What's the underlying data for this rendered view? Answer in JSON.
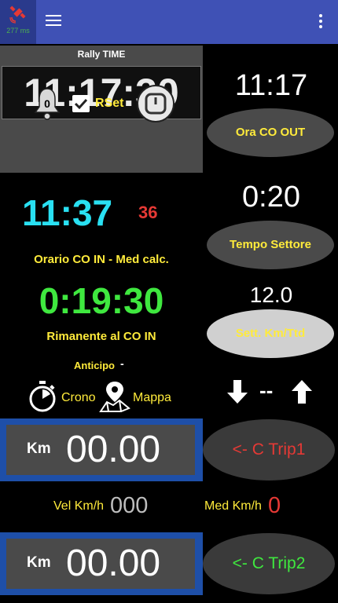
{
  "app_bar": {
    "gps_latency": "277 ms",
    "colors": {
      "bar": "#3f51b5",
      "gps_tile": "#2a3a8c",
      "gps_icon": "#e53935"
    }
  },
  "rally": {
    "title": "Rally TIME",
    "clock": "11:17:30",
    "bell_count": "0",
    "rset_label": "RSet",
    "rset_checked": true
  },
  "co_in": {
    "time": "11:37",
    "red_value": "36",
    "label": "Orario CO IN - Med calc.",
    "remaining_time": "0:19:30",
    "remaining_label": "Rimanente al CO IN",
    "anticipo_label": "Anticipo",
    "anticipo_value": "-"
  },
  "tools": {
    "crono_label": "Crono",
    "mappa_label": "Mappa"
  },
  "right": {
    "ora_co_out_value": "11:17",
    "ora_co_out_button": "Ora CO OUT",
    "tempo_settore_value": "0:20",
    "tempo_settore_button": "Tempo Settore",
    "sett_km_value": "12.0",
    "sett_km_button": "Sett. Km/Ttd",
    "arrow_separator": "--"
  },
  "trip1": {
    "km_label": "Km",
    "km_value": "00.00",
    "button": "<- C Trip1",
    "button_color": "#e53935"
  },
  "speed": {
    "vel_label": "Vel Km/h",
    "vel_value": "000",
    "med_label": "Med Km/h",
    "med_value": "0"
  },
  "trip2": {
    "km_label": "Km",
    "km_value": "00.00",
    "button": "<- C Trip2",
    "button_color": "#3fe83f"
  }
}
